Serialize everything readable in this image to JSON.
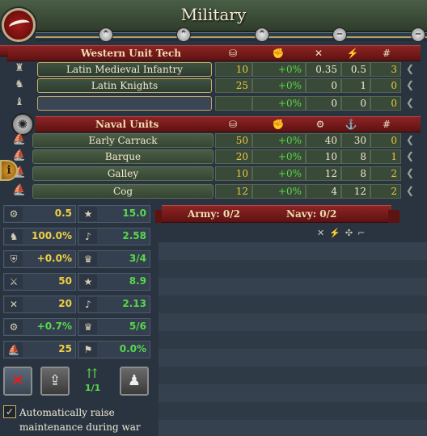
{
  "header": {
    "title": "Military"
  },
  "land": {
    "section_title": "Western Unit Tech",
    "units": [
      {
        "name": "Latin Medieval Infantry",
        "cost": "10",
        "mod": "+0%",
        "v1": "0.35",
        "v2": "0.5",
        "count": "3"
      },
      {
        "name": "Latin Knights",
        "cost": "25",
        "mod": "+0%",
        "v1": "0",
        "v2": "1",
        "count": "0"
      },
      {
        "name": "",
        "cost": "",
        "mod": "+0%",
        "v1": "0",
        "v2": "0",
        "count": "0"
      }
    ]
  },
  "naval": {
    "section_title": "Naval Units",
    "units": [
      {
        "name": "Early Carrack",
        "cost": "50",
        "mod": "+0%",
        "v1": "40",
        "v2": "30",
        "count": "0"
      },
      {
        "name": "Barque",
        "cost": "20",
        "mod": "+0%",
        "v1": "10",
        "v2": "8",
        "count": "1"
      },
      {
        "name": "Galley",
        "cost": "10",
        "mod": "+0%",
        "v1": "12",
        "v2": "8",
        "count": "2"
      },
      {
        "name": "Cog",
        "cost": "12",
        "mod": "+0%",
        "v1": "4",
        "v2": "12",
        "count": "2"
      }
    ]
  },
  "stats_left": [
    {
      "icon": "cannon-icon",
      "value": "0.5"
    },
    {
      "icon": "horse-army-icon",
      "value": "100.0%"
    },
    {
      "icon": "shield-icon",
      "value": "+0.0%"
    },
    {
      "icon": "spears-icon",
      "value": "50"
    },
    {
      "icon": "crossed-swords-icon",
      "value": "20"
    },
    {
      "icon": "artillery-icon",
      "value": "+0.7%"
    },
    {
      "icon": "ship-icon",
      "value": "25"
    }
  ],
  "stats_right": [
    {
      "icon": "tradition-star-icon",
      "value": "15.0"
    },
    {
      "icon": "trumpet-icon",
      "value": "2.58"
    },
    {
      "icon": "leaders-icon",
      "value": "3/4"
    },
    {
      "icon": "naval-tradition-icon",
      "value": "8.9"
    },
    {
      "icon": "naval-trumpet-icon",
      "value": "2.13"
    },
    {
      "icon": "admirals-icon",
      "value": "5/6"
    },
    {
      "icon": "flag-icon",
      "value": "0.0%"
    }
  ],
  "armies": {
    "army_label": "Army: 0/2",
    "navy_label": "Navy: 0/2"
  },
  "reinforce": {
    "label": "1/1"
  },
  "auto_raise": {
    "label": "Automatically raise maintenance during war",
    "checked": "✓"
  }
}
